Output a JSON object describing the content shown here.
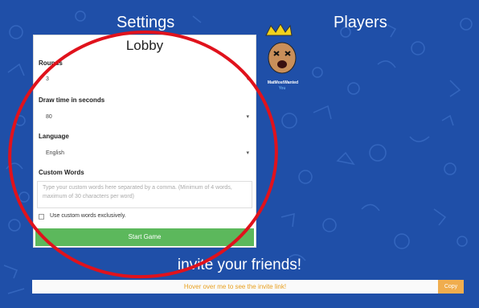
{
  "headings": {
    "settings": "Settings",
    "players": "Players"
  },
  "lobby": {
    "title": "Lobby",
    "rounds": {
      "label": "Rounds",
      "value": "3"
    },
    "draw_time": {
      "label": "Draw time in seconds",
      "value": "80"
    },
    "language": {
      "label": "Language",
      "value": "English"
    },
    "custom_words": {
      "label": "Custom Words",
      "placeholder": "Type your custom words here separated by a comma. (Minimum of 4 words, maximum of 30 characters per word)"
    },
    "exclusive_checkbox_label": "Use custom words exclusively.",
    "start_button": "Start Game"
  },
  "player": {
    "name": "MatMostWanted",
    "you_label": "You"
  },
  "invite": {
    "heading": "invite your friends!",
    "bar_text": "Hover over me to see the invite link!",
    "copy_label": "Copy"
  },
  "colors": {
    "background": "#1f4fa8",
    "start_button": "#5cb85c",
    "copy_button": "#f0ad4e",
    "annotation_circle": "#e0121c"
  },
  "icons": [
    "crown-icon",
    "avatar-icon",
    "caret-down-icon"
  ]
}
